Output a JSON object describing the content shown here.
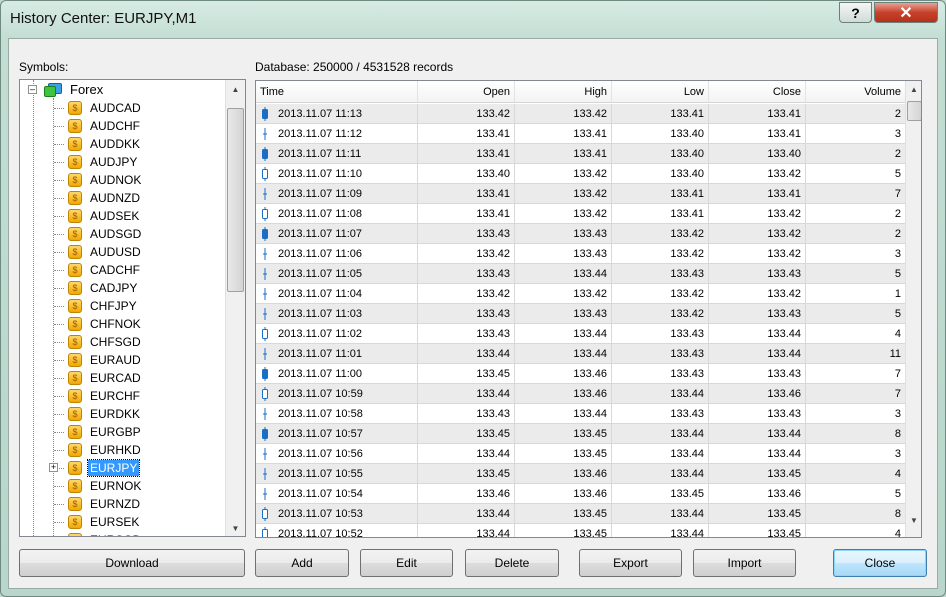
{
  "window": {
    "title": "History Center: EURJPY,M1",
    "help": "?",
    "close": "✕"
  },
  "symbols_label": "Symbols:",
  "database_label": "Database: 250000 / 4531528 records",
  "tree": {
    "root": "Forex",
    "selected": "EURJPY",
    "items": [
      "AUDCAD",
      "AUDCHF",
      "AUDDKK",
      "AUDJPY",
      "AUDNOK",
      "AUDNZD",
      "AUDSEK",
      "AUDSGD",
      "AUDUSD",
      "CADCHF",
      "CADJPY",
      "CHFJPY",
      "CHFNOK",
      "CHFSGD",
      "EURAUD",
      "EURCAD",
      "EURCHF",
      "EURDKK",
      "EURGBP",
      "EURHKD",
      "EURJPY",
      "EURNOK",
      "EURNZD",
      "EURSEK",
      "EURSGD"
    ]
  },
  "table": {
    "columns": [
      "Time",
      "Open",
      "High",
      "Low",
      "Close",
      "Volume"
    ],
    "rows": [
      [
        "2013.11.07 11:13",
        "133.42",
        "133.42",
        "133.41",
        "133.41",
        "2",
        "bear"
      ],
      [
        "2013.11.07 11:12",
        "133.41",
        "133.41",
        "133.40",
        "133.41",
        "3",
        "doji"
      ],
      [
        "2013.11.07 11:11",
        "133.41",
        "133.41",
        "133.40",
        "133.40",
        "2",
        "bear"
      ],
      [
        "2013.11.07 11:10",
        "133.40",
        "133.42",
        "133.40",
        "133.42",
        "5",
        "bull"
      ],
      [
        "2013.11.07 11:09",
        "133.41",
        "133.42",
        "133.41",
        "133.41",
        "7",
        "doji"
      ],
      [
        "2013.11.07 11:08",
        "133.41",
        "133.42",
        "133.41",
        "133.42",
        "2",
        "bull"
      ],
      [
        "2013.11.07 11:07",
        "133.43",
        "133.43",
        "133.42",
        "133.42",
        "2",
        "bear"
      ],
      [
        "2013.11.07 11:06",
        "133.42",
        "133.43",
        "133.42",
        "133.42",
        "3",
        "doji"
      ],
      [
        "2013.11.07 11:05",
        "133.43",
        "133.44",
        "133.43",
        "133.43",
        "5",
        "doji"
      ],
      [
        "2013.11.07 11:04",
        "133.42",
        "133.42",
        "133.42",
        "133.42",
        "1",
        "doji"
      ],
      [
        "2013.11.07 11:03",
        "133.43",
        "133.43",
        "133.42",
        "133.43",
        "5",
        "doji"
      ],
      [
        "2013.11.07 11:02",
        "133.43",
        "133.44",
        "133.43",
        "133.44",
        "4",
        "bull"
      ],
      [
        "2013.11.07 11:01",
        "133.44",
        "133.44",
        "133.43",
        "133.44",
        "11",
        "doji"
      ],
      [
        "2013.11.07 11:00",
        "133.45",
        "133.46",
        "133.43",
        "133.43",
        "7",
        "bear"
      ],
      [
        "2013.11.07 10:59",
        "133.44",
        "133.46",
        "133.44",
        "133.46",
        "7",
        "bull"
      ],
      [
        "2013.11.07 10:58",
        "133.43",
        "133.44",
        "133.43",
        "133.43",
        "3",
        "doji"
      ],
      [
        "2013.11.07 10:57",
        "133.45",
        "133.45",
        "133.44",
        "133.44",
        "8",
        "bear"
      ],
      [
        "2013.11.07 10:56",
        "133.44",
        "133.45",
        "133.44",
        "133.44",
        "3",
        "doji"
      ],
      [
        "2013.11.07 10:55",
        "133.45",
        "133.46",
        "133.44",
        "133.45",
        "4",
        "doji"
      ],
      [
        "2013.11.07 10:54",
        "133.46",
        "133.46",
        "133.45",
        "133.46",
        "5",
        "doji"
      ],
      [
        "2013.11.07 10:53",
        "133.44",
        "133.45",
        "133.44",
        "133.45",
        "8",
        "bull"
      ],
      [
        "2013.11.07 10:52",
        "133.44",
        "133.45",
        "133.44",
        "133.45",
        "4",
        "bull"
      ]
    ]
  },
  "buttons": {
    "download": "Download",
    "add": "Add",
    "edit": "Edit",
    "delete": "Delete",
    "export": "Export",
    "import": "Import",
    "close": "Close"
  },
  "colors": {
    "candle": "#1a6fc4",
    "selection": "#3399ff"
  }
}
